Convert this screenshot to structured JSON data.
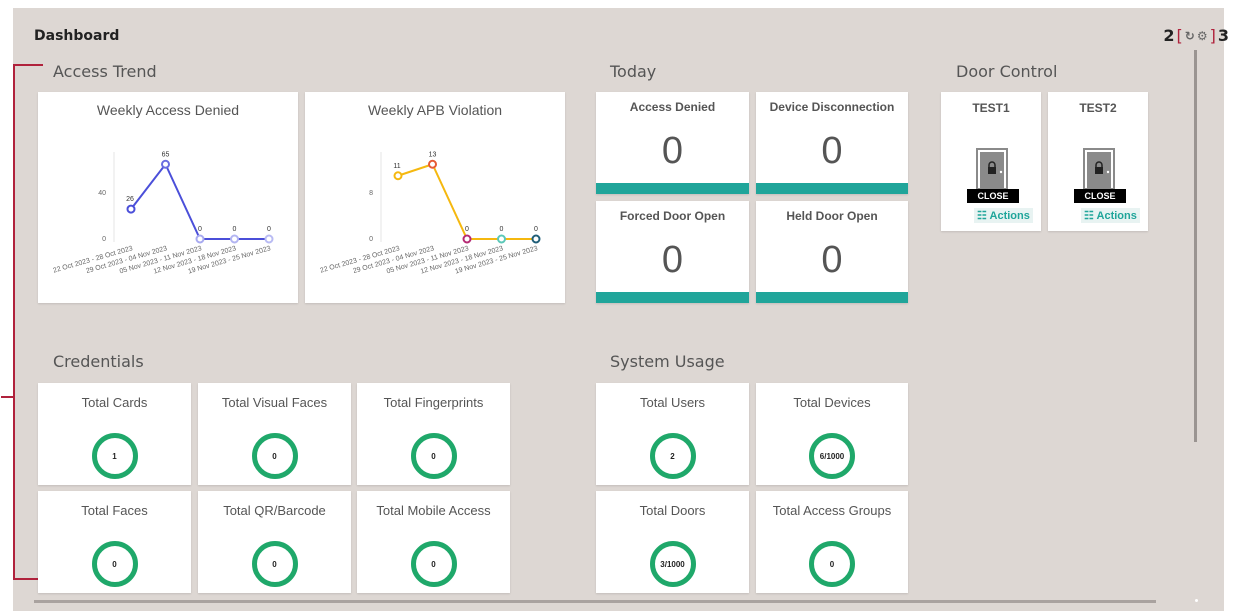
{
  "page": {
    "title": "Dashboard"
  },
  "header_icons": {
    "left_number": "2",
    "right_number": "3",
    "refresh_icon": "refresh-icon",
    "settings_icon": "gear-icon"
  },
  "sections": {
    "access_trend": "Access Trend",
    "today": "Today",
    "door_control": "Door Control",
    "credentials": "Credentials",
    "system_usage": "System Usage"
  },
  "charts": {
    "access_denied_title": "Weekly Access Denied",
    "apb_title": "Weekly APB Violation"
  },
  "chart_data": [
    {
      "type": "line",
      "title": "Weekly Access Denied",
      "categories": [
        "22 Oct 2023 - 28 Oct 2023",
        "29 Oct 2023 - 04 Nov 2023",
        "05 Nov 2023 - 11 Nov 2023",
        "12 Nov 2023 - 18 Nov 2023",
        "19 Nov 2023 - 25 Nov 2023"
      ],
      "series": [
        {
          "values": [
            26,
            65,
            0,
            0,
            0
          ]
        }
      ],
      "yticks": [
        "0",
        "40"
      ],
      "ylim": [
        0,
        80
      ],
      "point_colors": [
        "#4b4fd9",
        "#6a6de0",
        "#a8aaf0",
        "#b3b5f2",
        "#b9bbf3"
      ],
      "line_color": "#4b4fd9"
    },
    {
      "type": "line",
      "title": "Weekly APB Violation",
      "categories": [
        "22 Oct 2023 - 28 Oct 2023",
        "29 Oct 2023 - 04 Nov 2023",
        "05 Nov 2023 - 11 Nov 2023",
        "12 Nov 2023 - 18 Nov 2023",
        "19 Nov 2023 - 25 Nov 2023"
      ],
      "series": [
        {
          "values": [
            11,
            13,
            0,
            0,
            0
          ]
        }
      ],
      "yticks": [
        "0",
        "8"
      ],
      "ylim": [
        0,
        16
      ],
      "point_colors": [
        "#f5b80f",
        "#e65a34",
        "#b52a74",
        "#5cc8b8",
        "#1f5e78"
      ],
      "line_color": "#f5b80f"
    }
  ],
  "today": [
    {
      "label": "Access Denied",
      "value": "0"
    },
    {
      "label": "Device Disconnection",
      "value": "0"
    },
    {
      "label": "Forced Door Open",
      "value": "0"
    },
    {
      "label": "Held Door Open",
      "value": "0"
    }
  ],
  "doors": [
    {
      "name": "TEST1",
      "status": "CLOSE",
      "actions": "Actions"
    },
    {
      "name": "TEST2",
      "status": "CLOSE",
      "actions": "Actions"
    }
  ],
  "credentials": [
    {
      "label": "Total Cards",
      "value": "1"
    },
    {
      "label": "Total Visual Faces",
      "value": "0"
    },
    {
      "label": "Total Fingerprints",
      "value": "0"
    },
    {
      "label": "Total Faces",
      "value": "0"
    },
    {
      "label": "Total QR/Barcode",
      "value": "0"
    },
    {
      "label": "Total Mobile Access",
      "value": "0"
    }
  ],
  "system_usage": [
    {
      "label": "Total Users",
      "value": "2"
    },
    {
      "label": "Total Devices",
      "value": "6/1000"
    },
    {
      "label": "Total Doors",
      "value": "3/1000"
    },
    {
      "label": "Total Access Groups",
      "value": "0"
    }
  ],
  "colors": {
    "accent": "#20a59a",
    "ring": "#1fa86a",
    "annotation": "#b0223c",
    "panel": "#ddd7d3"
  }
}
